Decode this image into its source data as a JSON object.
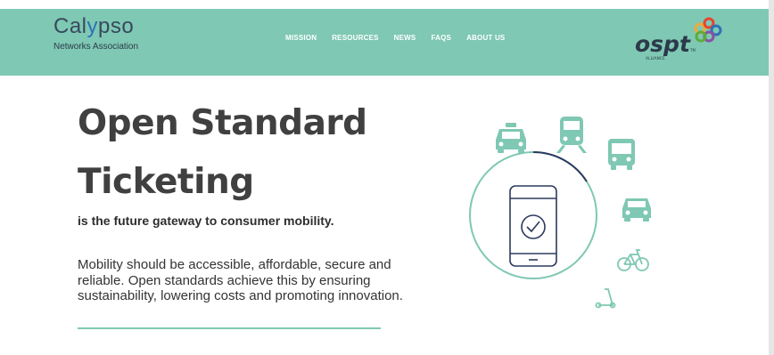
{
  "header": {
    "logo_name_pre": "Cal",
    "logo_name_accent": "y",
    "logo_name_post": "pso",
    "logo_sub": "Networks Association",
    "nav": [
      "MISSION",
      "RESOURCES",
      "NEWS",
      "FAQS",
      "ABOUT US"
    ],
    "partner_logo": "ospt",
    "partner_logo_sub": "ALLIANCE",
    "partner_logo_tm": "TM"
  },
  "hero": {
    "title": "Open Standard Ticketing",
    "tagline": "is the future gateway to consumer mobility.",
    "body": "Mobility should be accessible, affordable, secure and reliable. Open standards achieve this by ensuring sustainability, lowering costs and promoting innovation."
  },
  "illustration_icons": [
    "taxi-icon",
    "train-icon",
    "bus-icon",
    "car-icon",
    "bicycle-icon",
    "scooter-icon",
    "smartphone-check-icon"
  ],
  "colors": {
    "header_bg": "#7fc8b3",
    "accent": "#7fc8b3",
    "logo_text": "#36495e",
    "logo_accent": "#2d72b8",
    "title_text": "#404040",
    "phone_outline": "#2b3a5e"
  }
}
